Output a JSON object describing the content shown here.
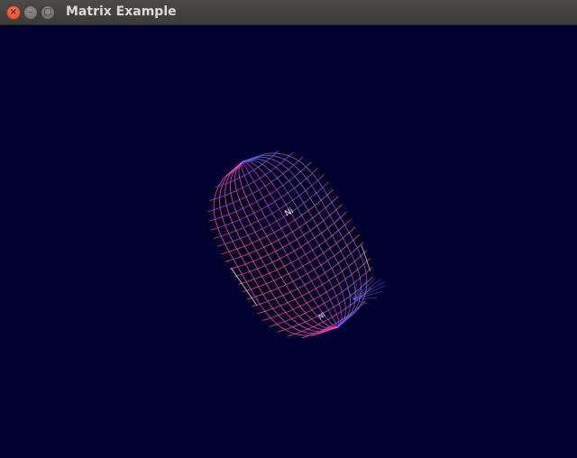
{
  "window": {
    "title": "Matrix Example",
    "controls": {
      "close_glyph": "×",
      "minimize_glyph": "–",
      "maximize_glyph": "□"
    }
  },
  "scene": {
    "background_color": "#000030",
    "object": "wireframe-capsule",
    "colors": {
      "pink": "#ff4fd0",
      "magenta": "#c040ff",
      "blue": "#6a6cff",
      "highlight": "#ffffff"
    },
    "surface_text_1": "Ni",
    "surface_text_2": "Ni"
  }
}
